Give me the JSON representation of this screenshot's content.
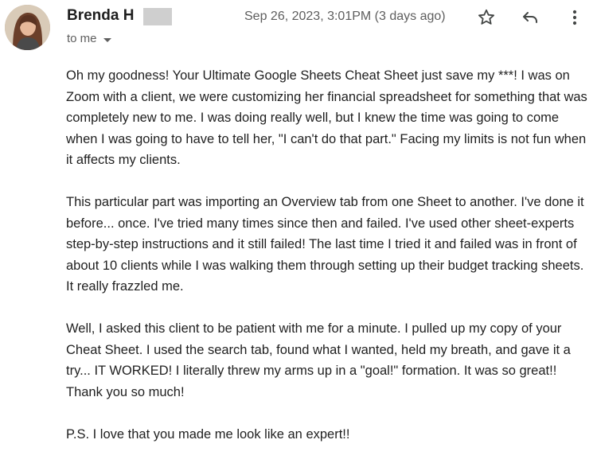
{
  "email": {
    "sender": {
      "name": "Brenda H",
      "avatar_icon": "profile-photo"
    },
    "recipient_label": "to me",
    "date": "Sep 26, 2023, 3:01PM (3 days ago)",
    "actions": {
      "star_icon": "star-icon",
      "reply_icon": "reply-icon",
      "more_icon": "more-vert-icon"
    },
    "paragraphs": [
      "Oh my goodness!  Your Ultimate Google Sheets Cheat Sheet just save my ***!  I was on Zoom with a client, we were customizing her financial spreadsheet for something that was completely new to me.  I was doing really well, but I knew the time was going to come when I was going to have to tell her, \"I can't do that part.\"  Facing my limits is not fun when it affects my clients.",
      "This particular part was importing an Overview tab from one Sheet to another. I've done it before... once.  I've tried many times since then and failed.  I've used other sheet-experts step-by-step instructions and it still failed!  The last time I tried it and failed was in front of about 10 clients while I was walking them through setting up their budget tracking sheets. It really frazzled me.",
      "Well, I asked this client to be patient with me for a minute.  I pulled up my copy of your Cheat Sheet.  I used the search tab, found what I wanted, held my breath, and gave it a try...  IT WORKED!  I literally threw my arms up in a \"goal!\" formation.  It was so great!! Thank you so much!",
      "P.S.  I love that you made me look like an expert!!"
    ]
  },
  "colors": {
    "text_primary": "#1f1f1f",
    "text_secondary": "#5e5e5e",
    "redaction": "#cfcfcf"
  }
}
